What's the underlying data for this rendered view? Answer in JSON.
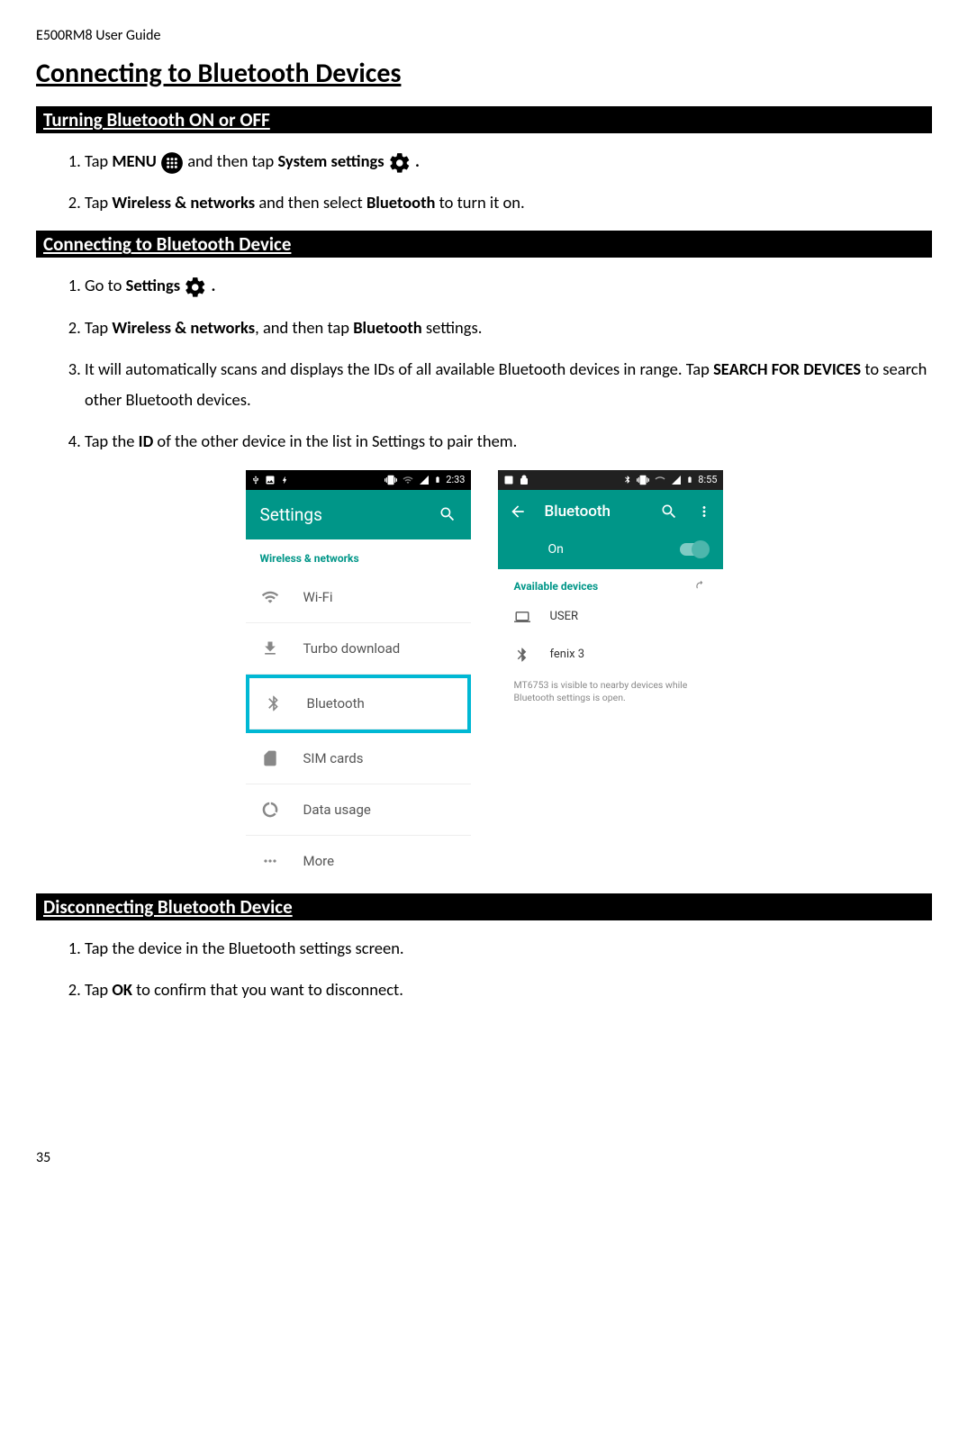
{
  "doc_header": "E500RM8 User Guide",
  "page_title": "Connecting to Bluetooth Devices",
  "section_a": {
    "header": "Turning Bluetooth ON or OFF",
    "step1_a": "Tap ",
    "step1_b": "MENU",
    "step1_c": " and then tap ",
    "step1_d": "System settings",
    "step1_e": ".",
    "step2_a": "Tap ",
    "step2_b": "Wireless & networks",
    "step2_c": " and then select ",
    "step2_d": "Bluetooth",
    "step2_e": " to turn it on."
  },
  "section_b": {
    "header": "Connecting to Bluetooth Device",
    "step1_a": "Go to ",
    "step1_b": "Settings",
    "step1_c": ".",
    "step2_a": "Tap ",
    "step2_b": "Wireless & networks",
    "step2_c": ", and then tap ",
    "step2_d": "Bluetooth",
    "step2_e": " settings.",
    "step3_a": "It will automatically scans and displays the IDs of all available Bluetooth devices in range. Tap ",
    "step3_b": "SEARCH FOR DEVICES",
    "step3_c": " to search other Bluetooth devices.",
    "step4_a": "Tap the ",
    "step4_b": "ID",
    "step4_c": " of the other device in the list in Settings to pair them."
  },
  "section_c": {
    "header": "Disconnecting Bluetooth Device",
    "step1": "Tap the device in the Bluetooth settings screen.",
    "step2_a": "Tap ",
    "step2_b": "OK",
    "step2_c": " to confirm that you want to disconnect."
  },
  "screenshot_left": {
    "time": "2:33",
    "title": "Settings",
    "section": "Wireless & networks",
    "items": {
      "wifi": "Wi-Fi",
      "turbo": "Turbo download",
      "bluetooth": "Bluetooth",
      "sim": "SIM cards",
      "data": "Data usage",
      "more": "More"
    }
  },
  "screenshot_right": {
    "time": "8:55",
    "title": "Bluetooth",
    "state": "On",
    "avail": "Available devices",
    "devices": {
      "user": "USER",
      "fenix": "fenix 3"
    },
    "info": "MT6753 is visible to nearby devices while Bluetooth settings is open."
  },
  "page_number": "35"
}
